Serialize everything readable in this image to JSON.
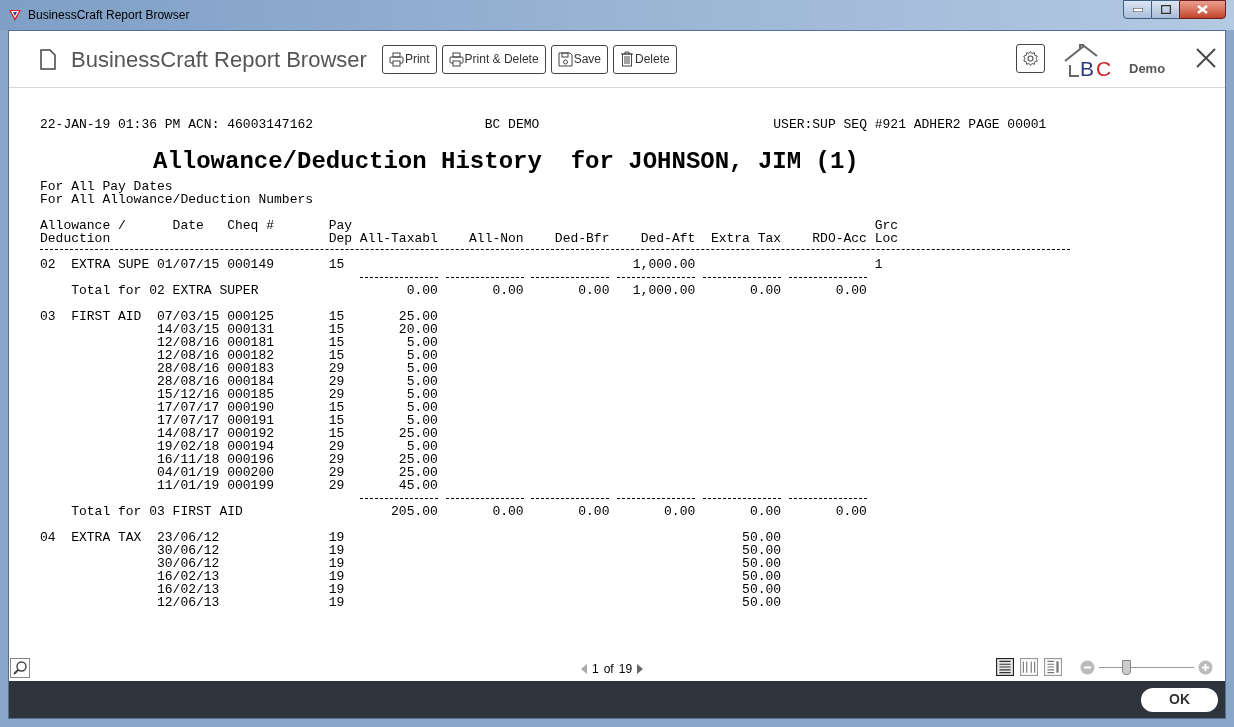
{
  "window": {
    "title": "BusinessCraft Report Browser"
  },
  "toolbar": {
    "title": "BusinessCraft Report Browser",
    "buttons": [
      {
        "kind": "print",
        "label": "Print"
      },
      {
        "kind": "print",
        "label": "Print & Delete"
      },
      {
        "kind": "save",
        "label": "Save"
      },
      {
        "kind": "delete",
        "label": "Delete"
      }
    ],
    "logo_letters": [
      "B",
      "C"
    ],
    "logo_caption": "Demo"
  },
  "report": {
    "header_left": "22-JAN-19 01:36 PM ACN: 46003147162",
    "header_center": "BC DEMO",
    "header_right": "USER:SUP SEQ #921 ADHER2 PAGE 00001",
    "title": "Allowance/Deduction History  for JOHNSON, JIM (1)",
    "filters": [
      "For All Pay Dates",
      "For All Allowance/Deduction Numbers"
    ],
    "columns": [
      [
        "Allowance /",
        "Deduction"
      ],
      [
        "Date"
      ],
      [
        "Cheq #"
      ],
      [
        "Pay",
        "Dep"
      ],
      [
        "All-Taxabl"
      ],
      [
        "All-Non"
      ],
      [
        "Ded-Bfr"
      ],
      [
        "Ded-Aft"
      ],
      [
        "Extra Tax"
      ],
      [
        "RDO-Acc"
      ],
      [
        "Grc",
        "Loc"
      ]
    ],
    "groups": [
      {
        "code": "02",
        "name": "EXTRA SUPE",
        "rows": [
          {
            "date": "01/07/15",
            "cheq": "000149",
            "pay": "15",
            "ded_aft": "1,000.00",
            "loc": "1"
          }
        ],
        "total": {
          "label": "Total for 02 EXTRA SUPER",
          "all_taxabl": "0.00",
          "all_non": "0.00",
          "ded_bfr": "0.00",
          "ded_aft": "1,000.00",
          "extra_tax": "0.00",
          "rdo_acc": "0.00"
        }
      },
      {
        "code": "03",
        "name": "FIRST AID",
        "rows": [
          {
            "date": "07/03/15",
            "cheq": "000125",
            "pay": "15",
            "all_taxabl": "25.00"
          },
          {
            "date": "14/03/15",
            "cheq": "000131",
            "pay": "15",
            "all_taxabl": "20.00"
          },
          {
            "date": "12/08/16",
            "cheq": "000181",
            "pay": "15",
            "all_taxabl": "5.00"
          },
          {
            "date": "12/08/16",
            "cheq": "000182",
            "pay": "15",
            "all_taxabl": "5.00"
          },
          {
            "date": "28/08/16",
            "cheq": "000183",
            "pay": "29",
            "all_taxabl": "5.00"
          },
          {
            "date": "28/08/16",
            "cheq": "000184",
            "pay": "29",
            "all_taxabl": "5.00"
          },
          {
            "date": "15/12/16",
            "cheq": "000185",
            "pay": "29",
            "all_taxabl": "5.00"
          },
          {
            "date": "17/07/17",
            "cheq": "000190",
            "pay": "15",
            "all_taxabl": "5.00"
          },
          {
            "date": "17/07/17",
            "cheq": "000191",
            "pay": "15",
            "all_taxabl": "5.00"
          },
          {
            "date": "14/08/17",
            "cheq": "000192",
            "pay": "15",
            "all_taxabl": "25.00"
          },
          {
            "date": "19/02/18",
            "cheq": "000194",
            "pay": "29",
            "all_taxabl": "5.00"
          },
          {
            "date": "16/11/18",
            "cheq": "000196",
            "pay": "29",
            "all_taxabl": "25.00"
          },
          {
            "date": "04/01/19",
            "cheq": "000200",
            "pay": "29",
            "all_taxabl": "25.00"
          },
          {
            "date": "11/01/19",
            "cheq": "000199",
            "pay": "29",
            "all_taxabl": "45.00"
          }
        ],
        "total": {
          "label": "Total for 03 FIRST AID",
          "all_taxabl": "205.00",
          "all_non": "0.00",
          "ded_bfr": "0.00",
          "ded_aft": "0.00",
          "extra_tax": "0.00",
          "rdo_acc": "0.00"
        }
      },
      {
        "code": "04",
        "name": "EXTRA TAX",
        "rows": [
          {
            "date": "23/06/12",
            "pay": "19",
            "extra_tax": "50.00"
          },
          {
            "date": "30/06/12",
            "pay": "19",
            "extra_tax": "50.00"
          },
          {
            "date": "30/06/12",
            "pay": "19",
            "extra_tax": "50.00"
          },
          {
            "date": "16/02/13",
            "pay": "19",
            "extra_tax": "50.00"
          },
          {
            "date": "16/02/13",
            "pay": "19",
            "extra_tax": "50.00"
          },
          {
            "date": "12/06/13",
            "pay": "19",
            "extra_tax": "50.00"
          }
        ]
      }
    ]
  },
  "footer": {
    "page": "1",
    "of": "of",
    "pages": "19",
    "views": [
      {
        "kind": "single",
        "selected": true
      },
      {
        "kind": "double",
        "selected": false
      },
      {
        "kind": "side",
        "selected": false
      }
    ],
    "zoom": {
      "level": 0.27
    }
  },
  "ok_button": "OK"
}
